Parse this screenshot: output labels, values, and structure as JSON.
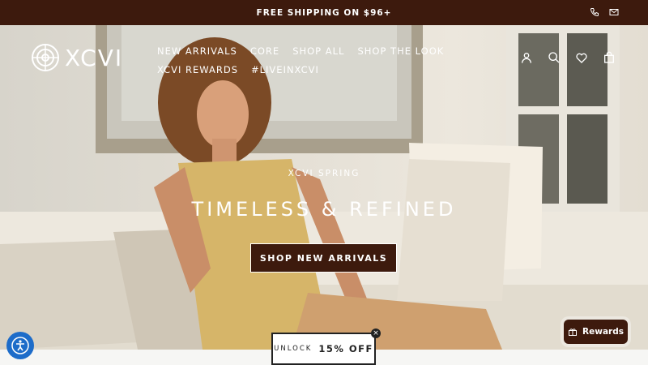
{
  "announcement": {
    "text": "FREE SHIPPING ON $96+"
  },
  "contact": {
    "phone_icon": "phone-icon",
    "mail_icon": "mail-icon"
  },
  "logo": {
    "text": "XCVI"
  },
  "nav": {
    "row1": [
      "NEW ARRIVALS",
      "CORE",
      "SHOP ALL",
      "SHOP THE LOOK"
    ],
    "row2": [
      "XCVI REWARDS",
      "#LIVEINXCVI"
    ]
  },
  "header_icons": [
    "account-icon",
    "search-icon",
    "wishlist-icon",
    "cart-icon"
  ],
  "hero": {
    "eyebrow": "XCVI SPRING",
    "headline": "TIMELESS & REFINED",
    "cta": "SHOP NEW ARRIVALS"
  },
  "popup": {
    "prefix": "UNLOCK",
    "offer": "15% OFF",
    "close": "×"
  },
  "rewards": {
    "label": "Rewards"
  },
  "colors": {
    "brand": "#3d1a0d",
    "accessibility": "#1d6cc9"
  }
}
